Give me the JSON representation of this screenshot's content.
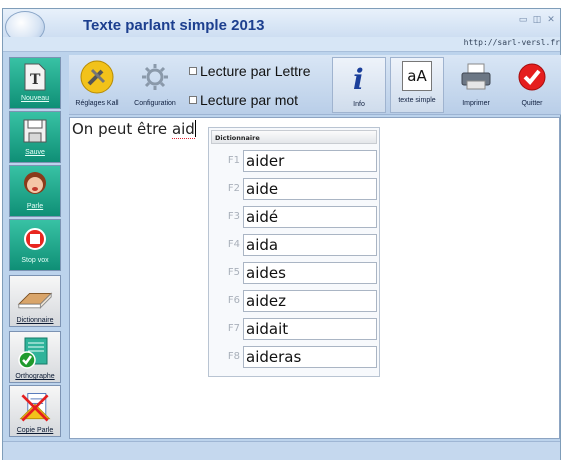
{
  "window": {
    "title": "Texte parlant simple 2013",
    "url": "http://sarl-versl.fr"
  },
  "toolbar": {
    "reglages_label": "Réglages Kall",
    "configuration_label": "Configuration",
    "lecture_lettre": "Lecture par Lettre",
    "lecture_mot": "Lecture par mot",
    "info_label": "Info",
    "texte_simple_label": "texte simple",
    "texte_simple_icon_text": "aA",
    "imprimer_label": "Imprimer",
    "quitter_label": "Quitter"
  },
  "sidebar": {
    "items": [
      {
        "label": "Nouveau",
        "icon": "new-document-icon"
      },
      {
        "label": "Sauve",
        "icon": "save-disk-icon"
      },
      {
        "label": "Parle",
        "icon": "speaking-face-icon"
      },
      {
        "label": "Stop vox",
        "icon": "stop-icon"
      },
      {
        "label": "Dictionnaire",
        "icon": "book-icon"
      },
      {
        "label": "Orthographe",
        "icon": "spellcheck-icon"
      },
      {
        "label": "Copie Parle",
        "icon": "copy-speak-icon"
      }
    ]
  },
  "editor": {
    "text_before": "On peut être ",
    "text_squiggle": "aid"
  },
  "dictionary": {
    "title": "Dictionnaire",
    "entries": [
      {
        "key": "F1",
        "word": "aider"
      },
      {
        "key": "F2",
        "word": "aide"
      },
      {
        "key": "F3",
        "word": "aidé"
      },
      {
        "key": "F4",
        "word": "aida"
      },
      {
        "key": "F5",
        "word": "aides"
      },
      {
        "key": "F6",
        "word": "aidez"
      },
      {
        "key": "F7",
        "word": "aidait"
      },
      {
        "key": "F8",
        "word": "aideras"
      }
    ]
  },
  "colors": {
    "accent_teal": "#14a083",
    "title_blue": "#1d3f8f",
    "window_bg": "#bcd3ec"
  }
}
